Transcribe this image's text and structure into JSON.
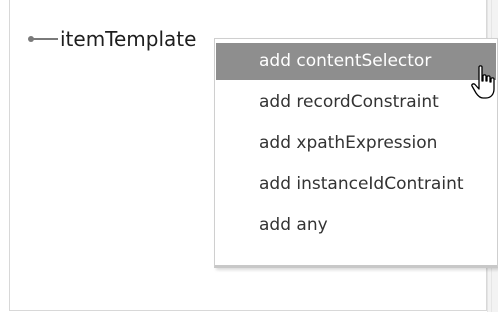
{
  "tree": {
    "node_label": "itemTemplate"
  },
  "context_menu": {
    "items": [
      {
        "label": "add contentSelector",
        "selected": true
      },
      {
        "label": "add recordConstraint",
        "selected": false
      },
      {
        "label": "add xpathExpression",
        "selected": false
      },
      {
        "label": "add instanceIdContraint",
        "selected": false
      },
      {
        "label": "add any",
        "selected": false
      }
    ]
  },
  "colors": {
    "highlight": "#8e8e8e",
    "highlight_text": "#ffffff",
    "menu_text": "#333333",
    "connector": "#7a7a7a"
  },
  "icons": {
    "cursor": "hand-pointer-icon",
    "tree_connector": "tree-connector-icon"
  }
}
